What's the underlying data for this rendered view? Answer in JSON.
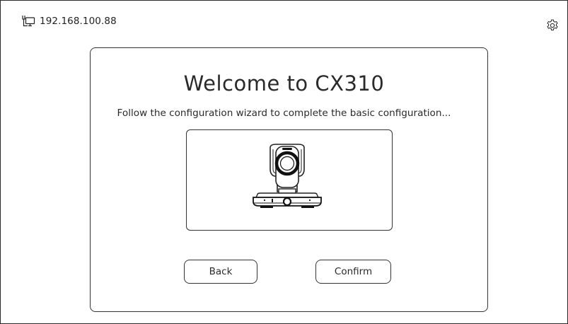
{
  "header": {
    "network_icon": "network-monitor-icon",
    "ip_address": "192.168.100.88",
    "settings_icon": "gear-icon"
  },
  "wizard": {
    "title": "Welcome to CX310",
    "subtitle": "Follow the configuration wizard to complete the basic configuration...",
    "image_icon": "ptz-camera-illustration",
    "back_label": "Back",
    "confirm_label": "Confirm"
  },
  "colors": {
    "background": "#ffffff",
    "border": "#333333",
    "text": "#2a2a2a"
  }
}
